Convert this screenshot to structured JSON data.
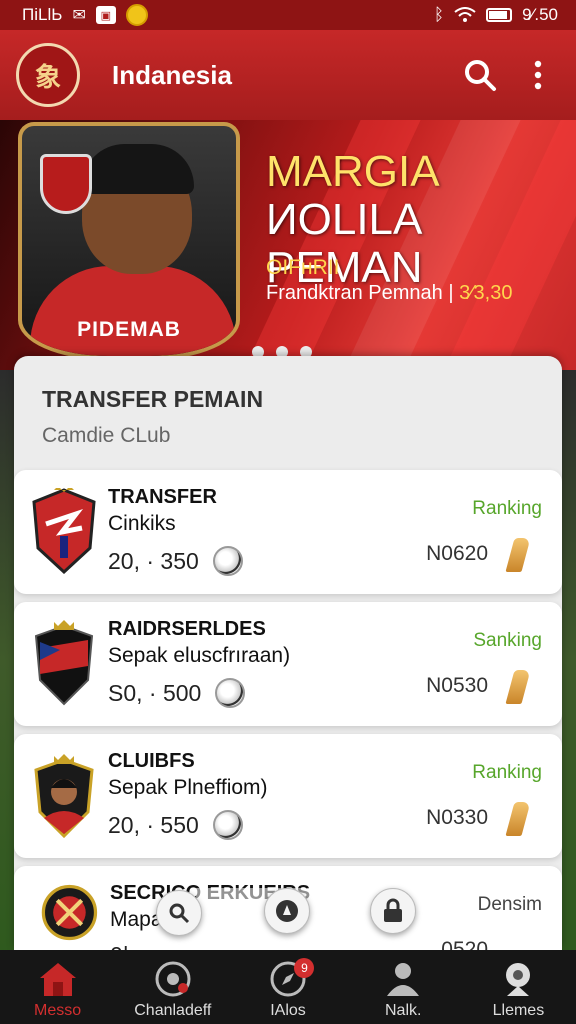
{
  "status_bar": {
    "left_text": "ΠiLlЬ",
    "right_text": "9⁄.50",
    "icon_bluetooth": "bluetooth-icon"
  },
  "app_bar": {
    "title": "Indanesia",
    "logo_text": "象"
  },
  "hero": {
    "title_line1_part1": "MARGIA",
    "title_line1_part2": " ИOLILA",
    "title_line2": "PEMAN",
    "subtitle": "OIFнRII",
    "line_label": "Frandktran Pemnah |",
    "line_value": " 3⁄3,30",
    "card_text": "PIDEMAB",
    "dots_count": 3
  },
  "panel": {
    "title": "TRANSFER PEMAIN",
    "subtitle": "Camdie CLub"
  },
  "transfers": [
    {
      "name": "TRANSFER",
      "desc": "Cinkiks",
      "price": "20, · 350",
      "rank": "Ranking",
      "code": "N0620"
    },
    {
      "name": "RAIDRSERLDES",
      "desc": "Sepak eluscfrıraan)",
      "price": "S0, · 500",
      "rank": "Sanking",
      "code": "N0530"
    },
    {
      "name": "CLUIBFS",
      "desc": "Sepak Plneffiom)",
      "price": "20, · 550",
      "rank": "Ranking",
      "code": "N0330"
    },
    {
      "name": "SECRICO ERKUEIRS",
      "desc": "Mapa",
      "price": "0|...",
      "rank": "Densim",
      "code": "0520"
    }
  ],
  "bottom_nav": [
    {
      "label": "Messo",
      "icon": "home-icon",
      "active": true
    },
    {
      "label": "Chanladeff",
      "icon": "stadium-icon",
      "active": false
    },
    {
      "label": "IAlos",
      "icon": "compass-icon",
      "active": false,
      "badge": "9"
    },
    {
      "label": "Nalk.",
      "icon": "person-icon",
      "active": false
    },
    {
      "label": "Llemes",
      "icon": "trophy-icon",
      "active": false
    }
  ],
  "colors": {
    "primary": "#c62828",
    "accent_gold": "#ffd64d",
    "rank_green": "#57a62b"
  }
}
